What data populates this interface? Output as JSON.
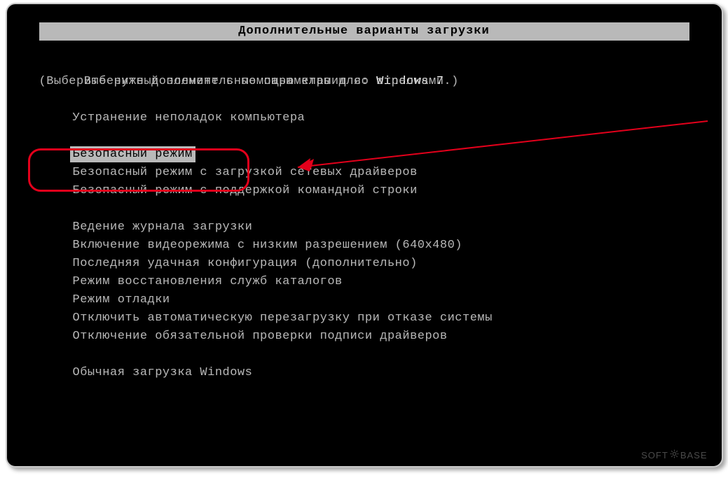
{
  "title": "Дополнительные варианты загрузки",
  "prompt_prefix": "Выберите дополнительные параметры для: ",
  "os_name": "Windows 7",
  "hint": "(Выберите нужный элемент с помощью клавиш со стрелками.)",
  "groups": [
    {
      "items": [
        {
          "label": "Устранение неполадок компьютера",
          "selected": false
        }
      ]
    },
    {
      "items": [
        {
          "label": "Безопасный режим",
          "selected": true
        },
        {
          "label": "Безопасный режим с загрузкой сетевых драйверов",
          "selected": false
        },
        {
          "label": "Безопасный режим с поддержкой командной строки",
          "selected": false
        }
      ]
    },
    {
      "items": [
        {
          "label": "Ведение журнала загрузки",
          "selected": false
        },
        {
          "label": "Включение видеорежима с низким разрешением (640x480)",
          "selected": false
        },
        {
          "label": "Последняя удачная конфигурация (дополнительно)",
          "selected": false
        },
        {
          "label": "Режим восстановления служб каталогов",
          "selected": false
        },
        {
          "label": "Режим отладки",
          "selected": false
        },
        {
          "label": "Отключить автоматическую перезагрузку при отказе системы",
          "selected": false
        },
        {
          "label": "Отключение обязательной проверки подписи драйверов",
          "selected": false
        }
      ]
    },
    {
      "items": [
        {
          "label": "Обычная загрузка Windows",
          "selected": false
        }
      ]
    }
  ],
  "watermark_left": "SOFT",
  "watermark_right": "BASE",
  "annotation_color": "#e3001b"
}
